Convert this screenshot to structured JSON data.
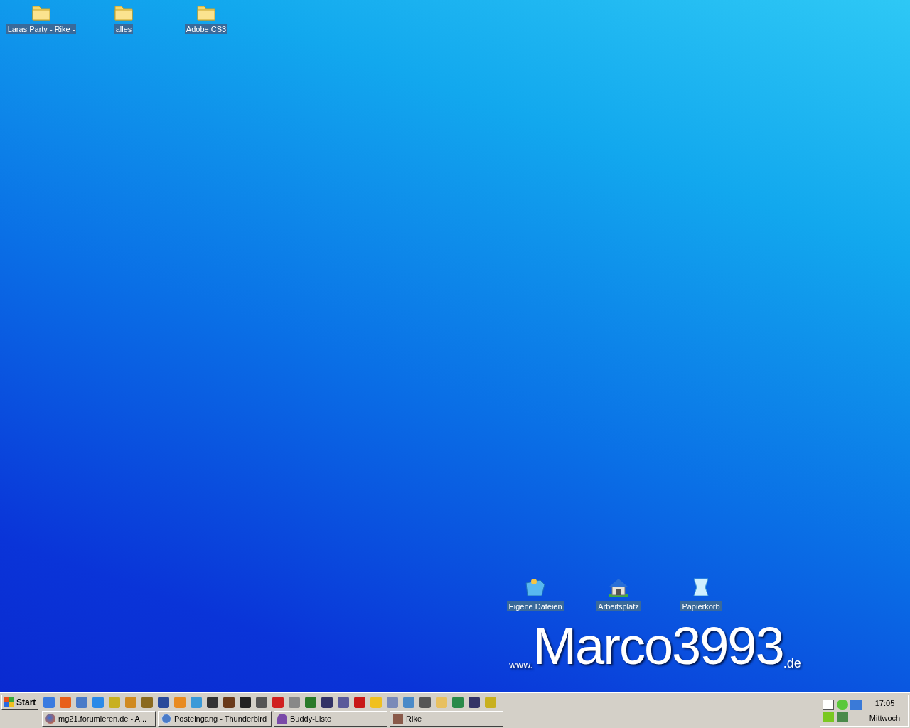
{
  "desktop": {
    "icons": [
      {
        "label": "Laras Party - Rike -",
        "kind": "folder"
      },
      {
        "label": "alles",
        "kind": "folder"
      },
      {
        "label": "Adobe CS3",
        "kind": "folder"
      },
      {
        "label": "Eigene Dateien",
        "kind": "documents"
      },
      {
        "label": "Arbeitsplatz",
        "kind": "computer"
      },
      {
        "label": "Papierkorb",
        "kind": "trash"
      }
    ],
    "wallpaper_logo": {
      "prefix": "www.",
      "name": "Marco3993",
      "suffix": ".de"
    }
  },
  "taskbar": {
    "start_label": "Start",
    "tasks": [
      {
        "label": "mg21.forumieren.de - A...",
        "kind": "browser"
      },
      {
        "label": "Posteingang - Thunderbird",
        "kind": "mail"
      },
      {
        "label": "Buddy-Liste",
        "kind": "chat"
      },
      {
        "label": "Rike",
        "kind": "photo"
      }
    ],
    "clock": {
      "time": "17:05",
      "day": "Mittwoch"
    }
  }
}
